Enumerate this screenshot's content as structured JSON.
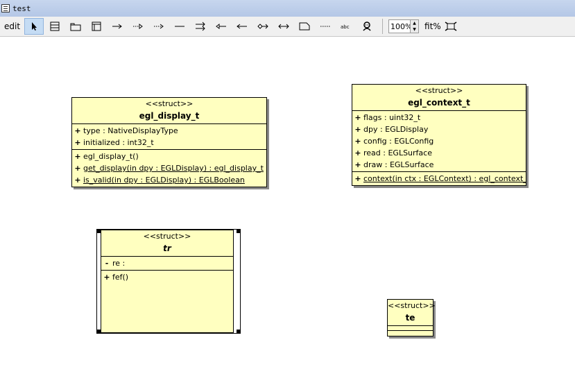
{
  "window": {
    "title": "test",
    "icon": "uml-doc-icon"
  },
  "toolbar": {
    "edit_label": "edit",
    "tools": [
      {
        "name": "select-tool",
        "icon": "arrow-pointer-icon",
        "active": true
      },
      {
        "name": "class-tool",
        "icon": "class-box-icon"
      },
      {
        "name": "package-tool",
        "icon": "folder-icon"
      },
      {
        "name": "note-tool",
        "icon": "note-icon"
      },
      {
        "name": "association-tool",
        "icon": "solid-arrow-icon"
      },
      {
        "name": "dependency-tool",
        "icon": "dotted-arrow-icon"
      },
      {
        "name": "realization-tool",
        "icon": "dotted-open-arrow-icon"
      },
      {
        "name": "line-tool",
        "icon": "line-icon"
      },
      {
        "name": "aggregation-tool",
        "icon": "double-arrow-icon"
      },
      {
        "name": "generalization-left-tool",
        "icon": "left-arrow-hollow-icon"
      },
      {
        "name": "navigation-left-tool",
        "icon": "left-arrow-icon"
      },
      {
        "name": "diamond-link-tool",
        "icon": "diamond-arrow-icon"
      },
      {
        "name": "bidirectional-tool",
        "icon": "bidirectional-arrow-icon"
      },
      {
        "name": "tag-tool",
        "icon": "tag-shape-icon"
      },
      {
        "name": "dotted-line-tool",
        "icon": "dotted-line-icon"
      },
      {
        "name": "text-tool",
        "icon": "abc-text-icon"
      },
      {
        "name": "actor-tool",
        "icon": "actor-icon"
      }
    ],
    "zoom_value": "100%",
    "fit_label": "fit%",
    "fit_icon": "fit-to-window-icon"
  },
  "classes": {
    "egl_display_t": {
      "stereotype": "<<struct>>",
      "name": "egl_display_t",
      "attributes": [
        {
          "vis": "+",
          "text": "type : NativeDisplayType"
        },
        {
          "vis": "+",
          "text": "initialized : int32_t"
        }
      ],
      "operations": [
        {
          "vis": "+",
          "text": "egl_display_t()",
          "static": false
        },
        {
          "vis": "+",
          "text": "get_display(in dpy : EGLDisplay) : egl_display_t",
          "static": true
        },
        {
          "vis": "+",
          "text": "is_valid(in dpy : EGLDisplay) : EGLBoolean",
          "static": true
        }
      ]
    },
    "egl_context_t": {
      "stereotype": "<<struct>>",
      "name": "egl_context_t",
      "attributes": [
        {
          "vis": "+",
          "text": "flags : uint32_t"
        },
        {
          "vis": "+",
          "text": "dpy : EGLDisplay"
        },
        {
          "vis": "+",
          "text": "config : EGLConfig"
        },
        {
          "vis": "+",
          "text": "read : EGLSurface"
        },
        {
          "vis": "+",
          "text": "draw : EGLSurface"
        }
      ],
      "operations": [
        {
          "vis": "+",
          "text": "context(in ctx : EGLContext) : egl_context_t",
          "static": true
        }
      ]
    },
    "tr": {
      "stereotype": "<<struct>>",
      "name": "tr",
      "attributes": [
        {
          "vis": "-",
          "text": "re :"
        }
      ],
      "operations": [
        {
          "vis": "+",
          "text": "fef()"
        }
      ]
    },
    "te": {
      "stereotype": "<<struct>>",
      "name": "te"
    }
  }
}
